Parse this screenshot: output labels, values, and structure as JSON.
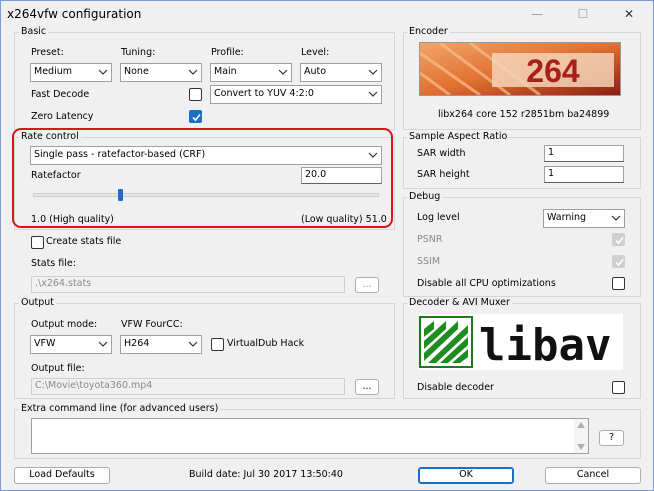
{
  "window": {
    "title": "x264vfw configuration"
  },
  "basic": {
    "group_label": "Basic",
    "preset": {
      "label": "Preset:",
      "value": "Medium"
    },
    "tuning": {
      "label": "Tuning:",
      "value": "None"
    },
    "profile": {
      "label": "Profile:",
      "value": "Main"
    },
    "level": {
      "label": "Level:",
      "value": "Auto"
    },
    "fast_decode": {
      "label": "Fast Decode",
      "checked": false
    },
    "colorspace": {
      "value": "Convert to YUV 4:2:0"
    },
    "zero_latency": {
      "label": "Zero Latency",
      "checked": true
    }
  },
  "rate_control": {
    "group_label": "Rate control",
    "mode": "Single pass - ratefactor-based (CRF)",
    "ratefactor_label": "Ratefactor",
    "ratefactor_value": "20.0",
    "slider_fraction": 0.25,
    "min_label": "1.0 (High quality)",
    "max_label": "(Low quality) 51.0"
  },
  "stats": {
    "create_label": "Create stats file",
    "file_label": "Stats file:",
    "file_value": ".\\x264.stats",
    "browse_label": "..."
  },
  "output": {
    "group_label": "Output",
    "mode_label": "Output mode:",
    "mode_value": "VFW",
    "fourcc_label": "VFW FourCC:",
    "fourcc_value": "H264",
    "vdub_label": "VirtualDub Hack",
    "file_label": "Output file:",
    "file_value": "C:\\Movie\\toyota360.mp4",
    "browse_label": "..."
  },
  "encoder": {
    "group_label": "Encoder",
    "logo_text": "264",
    "version": "libx264 core 152 r2851bm ba24899"
  },
  "sar": {
    "group_label": "Sample Aspect Ratio",
    "width_label": "SAR width",
    "width_value": "1",
    "height_label": "SAR height",
    "height_value": "1"
  },
  "debug": {
    "group_label": "Debug",
    "log_label": "Log level",
    "log_value": "Warning",
    "psnr_label": "PSNR",
    "ssim_label": "SSIM",
    "cpu_label": "Disable all CPU optimizations"
  },
  "decoder": {
    "group_label": "Decoder & AVI Muxer",
    "logo_text": "libav",
    "disable_label": "Disable decoder"
  },
  "extra": {
    "group_label": "Extra command line (for advanced users)",
    "help_label": "?"
  },
  "footer": {
    "load_defaults": "Load Defaults",
    "build_date": "Build date: Jul 30 2017 13:50:40",
    "ok": "OK",
    "cancel": "Cancel"
  },
  "colors": {
    "highlight": "#d9141b",
    "accent": "#1a6fc7"
  }
}
